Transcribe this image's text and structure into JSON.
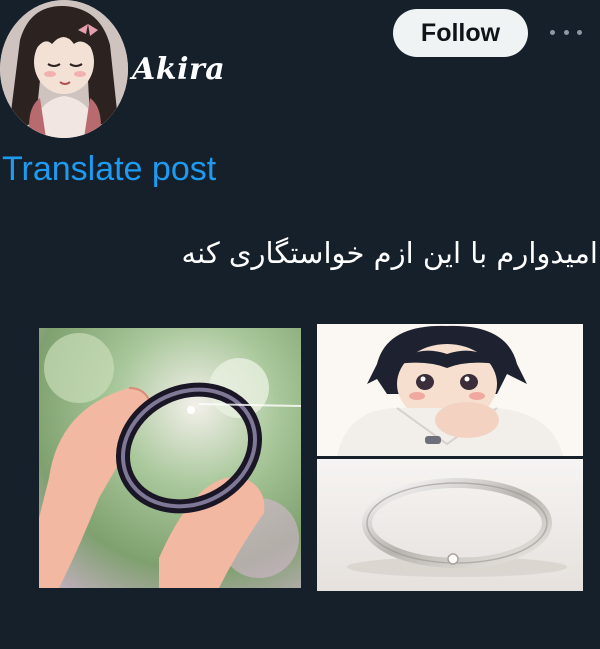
{
  "header": {
    "username": "Akira",
    "follow_label": "Follow",
    "more_icon": "more-horizontal-icon"
  },
  "post": {
    "translate_label": "Translate post",
    "text": "امیدوارم با این ازم خواستگاری کنه"
  },
  "media": [
    {
      "name": "anime-ring-held-in-fingers"
    },
    {
      "name": "anime-boy-wearing-ring"
    },
    {
      "name": "silver-ring-photo"
    }
  ],
  "colors": {
    "background": "#15202b",
    "accent": "#1d9bf0",
    "button_bg": "#eff3f4",
    "text": "#ffffff",
    "muted": "#8b98a5"
  }
}
